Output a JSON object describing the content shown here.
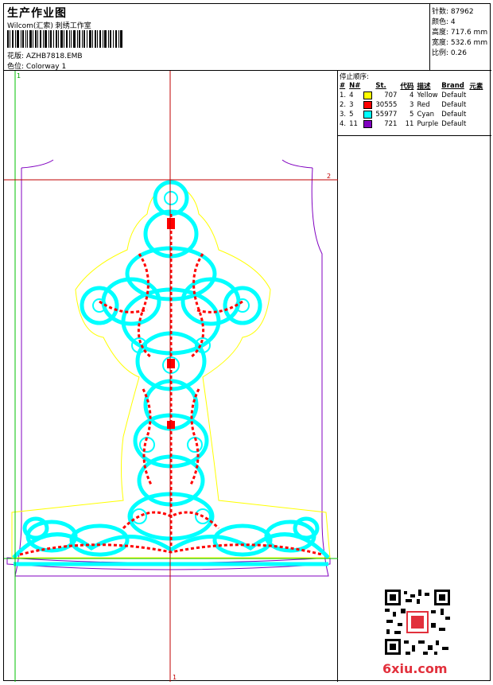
{
  "header": {
    "title": "生产作业图",
    "company": "Wilcom(汇索) 刺绣工作室",
    "design_label": "花版:",
    "design_value": "AZHB7818.EMB",
    "colorway_label": "色位:",
    "colorway_value": "Colorway 1"
  },
  "specs": [
    {
      "label": "针数:",
      "value": "87962"
    },
    {
      "label": "颜色:",
      "value": "4"
    },
    {
      "label": "高度:",
      "value": "717.6 mm"
    },
    {
      "label": "宽度:",
      "value": "532.6 mm"
    },
    {
      "label": "比例:",
      "value": "0.26"
    }
  ],
  "stops": {
    "caption": "停止顺序:",
    "columns": [
      "#",
      "N#",
      "St.",
      "代码",
      "描述",
      "Brand",
      "元素"
    ],
    "rows": [
      {
        "idx": "1.",
        "n": "4",
        "color": "#ffff00",
        "st": "707",
        "code": "4",
        "desc": "Yellow",
        "brand": "Default"
      },
      {
        "idx": "2.",
        "n": "3",
        "color": "#ff0000",
        "st": "30555",
        "code": "3",
        "desc": "Red",
        "brand": "Default"
      },
      {
        "idx": "3.",
        "n": "5",
        "color": "#00ffff",
        "st": "55977",
        "code": "5",
        "desc": "Cyan",
        "brand": "Default"
      },
      {
        "idx": "4.",
        "n": "11",
        "color": "#8000c0",
        "st": "721",
        "code": "11",
        "desc": "Purple",
        "brand": "Default"
      }
    ]
  },
  "markers": {
    "one": "1",
    "two": "2"
  },
  "watermark": "6xiu.com",
  "colors": {
    "yellow": "#ffff00",
    "red": "#ff0000",
    "cyan": "#00ffff",
    "purple": "#8000c0",
    "guide_green": "#00c000",
    "guide_red": "#c00000"
  }
}
